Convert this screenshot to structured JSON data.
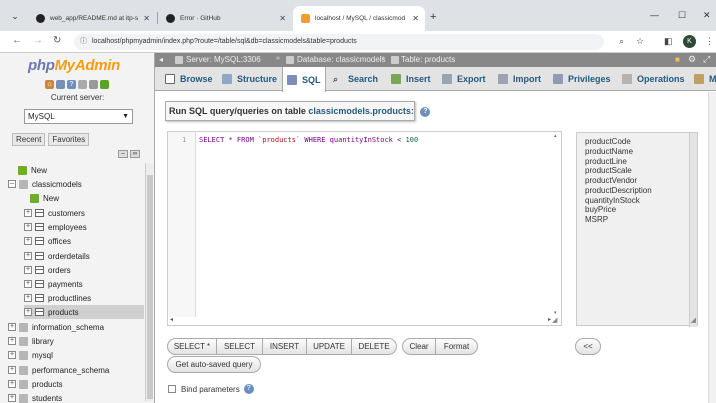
{
  "browser": {
    "tabs": [
      {
        "title": "web_app/README.md at itp-s",
        "close": "✕"
      },
      {
        "title": "Error · GitHub",
        "close": "✕"
      },
      {
        "title": "localhost / MySQL / classicmod",
        "close": "✕"
      }
    ],
    "new_tab": "+",
    "url": "localhost/phpmyadmin/index.php?route=/table/sql&db=classicmodels&table=products",
    "profile_initial": "K"
  },
  "pma": {
    "logo_php": "php",
    "logo_myadmin": "MyAdmin",
    "current_server_label": "Current server:",
    "server_value": "MySQL",
    "left_tabs": [
      "Recent",
      "Favorites"
    ],
    "tree": {
      "new_root": "New",
      "classicmodels": "classicmodels",
      "new_db": "New",
      "tables": [
        "customers",
        "employees",
        "offices",
        "orderdetails",
        "orders",
        "payments",
        "productlines",
        "products"
      ],
      "other_dbs": [
        "information_schema",
        "library",
        "mysql",
        "performance_schema",
        "products",
        "students"
      ]
    },
    "breadcrumb": {
      "server": "Server: MySQL:3306",
      "database": "Database: classicmodels",
      "table": "Table: products"
    },
    "menu_tabs": [
      "Browse",
      "Structure",
      "SQL",
      "Search",
      "Insert",
      "Export",
      "Import",
      "Privileges",
      "Operations",
      "M"
    ],
    "run_sql_prefix": "Run SQL query/queries on table",
    "run_sql_table": "classicmodels.products:",
    "editor": {
      "line_number": "1",
      "sql_select": "SELECT * FROM ",
      "sql_table": "`products`",
      "sql_where": " WHERE quantityInStock < ",
      "sql_number": "100"
    },
    "columns": [
      "productCode",
      "productName",
      "productLine",
      "productScale",
      "productVendor",
      "productDescription",
      "quantityInStock",
      "buyPrice",
      "MSRP"
    ],
    "buttons": {
      "select_star": "SELECT *",
      "select": "SELECT",
      "insert": "INSERT",
      "update": "UPDATE",
      "delete": "DELETE",
      "clear": "Clear",
      "format": "Format",
      "insert_col": "<<",
      "get_autosaved": "Get auto-saved query"
    },
    "bind_parameters": "Bind parameters"
  }
}
